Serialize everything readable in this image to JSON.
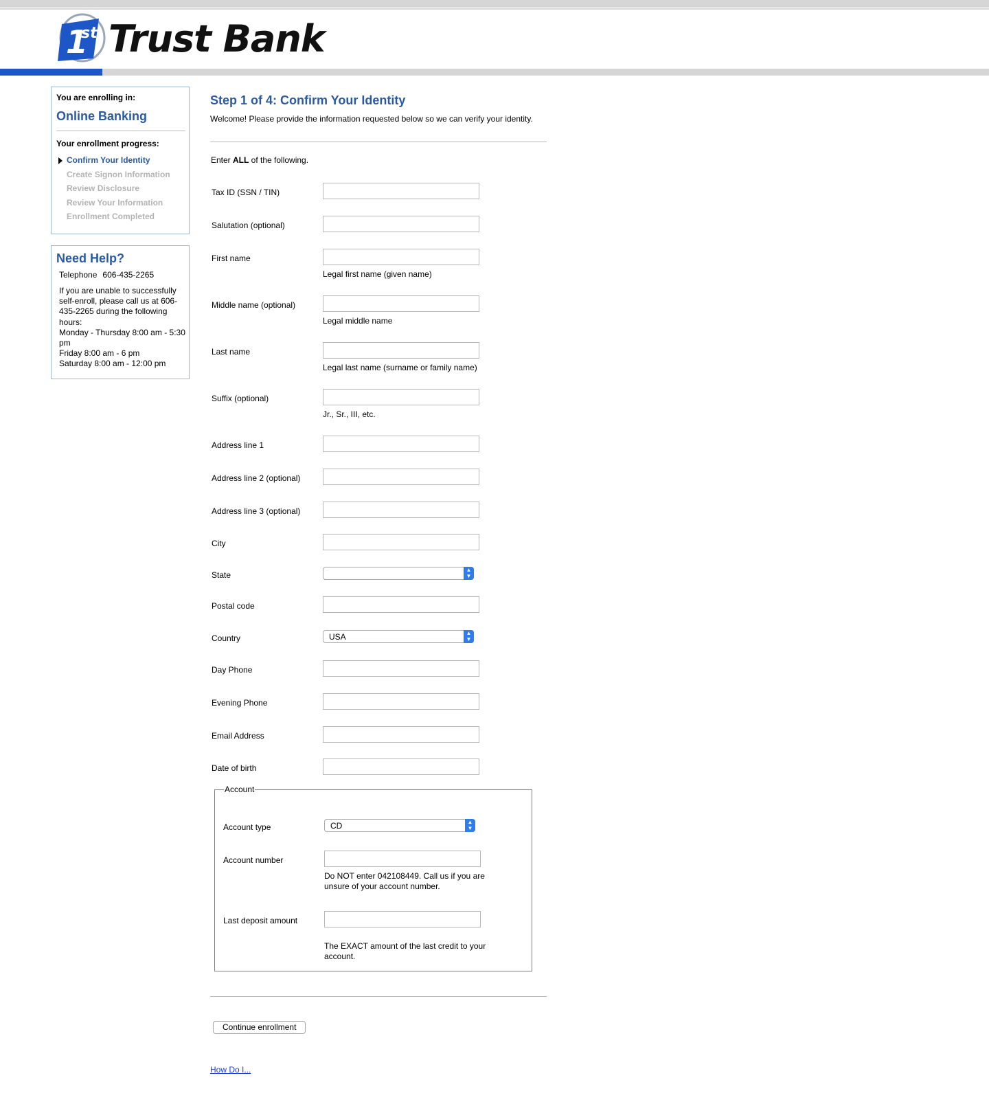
{
  "brand": {
    "name": "Trust Bank",
    "badge_text": "1st",
    "accent": "#1d57c7"
  },
  "sidebar": {
    "enrolling_label": "You are enrolling in:",
    "product": "Online Banking",
    "progress_label": "Your enrollment progress:",
    "steps": [
      {
        "label": "Confirm Your Identity",
        "current": true
      },
      {
        "label": "Create Signon Information",
        "current": false
      },
      {
        "label": "Review Disclosure",
        "current": false
      },
      {
        "label": "Review Your Information",
        "current": false
      },
      {
        "label": "Enrollment Completed",
        "current": false
      }
    ],
    "help": {
      "title": "Need Help?",
      "phone_label": "Telephone",
      "phone": "606-435-2265",
      "text_lines": [
        "If you are unable to successfully self-enroll, please call us at 606-435-2265 during the following hours:",
        "Monday - Thursday 8:00 am - 5:30 pm",
        "Friday 8:00 am - 6 pm",
        "Saturday 8:00 am - 12:00 pm"
      ]
    }
  },
  "main": {
    "title": "Step 1 of 4: Confirm Your Identity",
    "welcome": "Welcome! Please provide the information requested below so we can verify your identity.",
    "instruction_prefix": "Enter ",
    "instruction_bold": "ALL",
    "instruction_suffix": " of the following.",
    "fields": {
      "tax_id": {
        "label": "Tax ID (SSN / TIN)",
        "value": ""
      },
      "salutation": {
        "label": "Salutation (optional)",
        "value": ""
      },
      "first_name": {
        "label": "First name",
        "hint": "Legal first name (given name)",
        "value": ""
      },
      "middle_name": {
        "label": "Middle name (optional)",
        "hint": "Legal middle name",
        "value": ""
      },
      "last_name": {
        "label": "Last name",
        "hint": "Legal last name (surname or family name)",
        "value": ""
      },
      "suffix": {
        "label": "Suffix (optional)",
        "hint": "Jr., Sr., III, etc.",
        "value": ""
      },
      "address1": {
        "label": "Address line 1",
        "value": ""
      },
      "address2": {
        "label": "Address line 2 (optional)",
        "value": ""
      },
      "address3": {
        "label": "Address line 3 (optional)",
        "value": ""
      },
      "city": {
        "label": "City",
        "value": ""
      },
      "state": {
        "label": "State",
        "value": ""
      },
      "postal_code": {
        "label": "Postal code",
        "value": ""
      },
      "country": {
        "label": "Country",
        "value": "USA"
      },
      "day_phone": {
        "label": "Day Phone",
        "value": ""
      },
      "evening_phone": {
        "label": "Evening Phone",
        "value": ""
      },
      "email": {
        "label": "Email Address",
        "value": ""
      },
      "dob": {
        "label": "Date of birth",
        "value": ""
      }
    },
    "account": {
      "legend": "Account",
      "type_label": "Account type",
      "type_value": "CD",
      "number_label": "Account number",
      "number_hint": "Do NOT enter 042108449. Call us if you are unsure of your account number.",
      "deposit_label": "Last deposit amount",
      "deposit_hint": "The EXACT amount of the last credit to your account."
    },
    "continue_button": "Continue enrollment",
    "how_do_i_link": "How Do I..."
  }
}
